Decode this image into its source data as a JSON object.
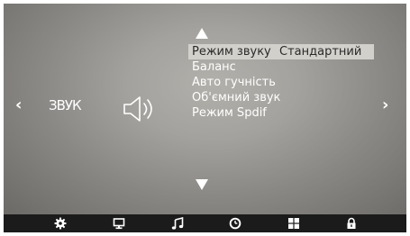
{
  "section": {
    "title": "ЗВУК",
    "icon": "speaker-icon"
  },
  "navigation": {
    "left_arrow": "‹",
    "right_arrow": "›",
    "up_icon": "triangle-up-icon",
    "down_icon": "triangle-down-icon"
  },
  "menu": {
    "items": [
      {
        "label": "Режим звуку",
        "value": "Стандартний",
        "selected": true
      },
      {
        "label": "Баланс"
      },
      {
        "label": "Авто гучність"
      },
      {
        "label": "Об'ємний звук"
      },
      {
        "label": "Режим Spdif"
      }
    ]
  },
  "bottom_bar": {
    "icons": [
      "gear-icon",
      "monitor-icon",
      "music-note-icon",
      "clock-icon",
      "grid-icon",
      "lock-icon"
    ],
    "active_icon": "music-note-icon"
  },
  "colors": {
    "highlight": "#d2d0cb",
    "highlight_text": "#2a2a2a",
    "text": "#ffffff",
    "bar": "#1b1b1b"
  }
}
